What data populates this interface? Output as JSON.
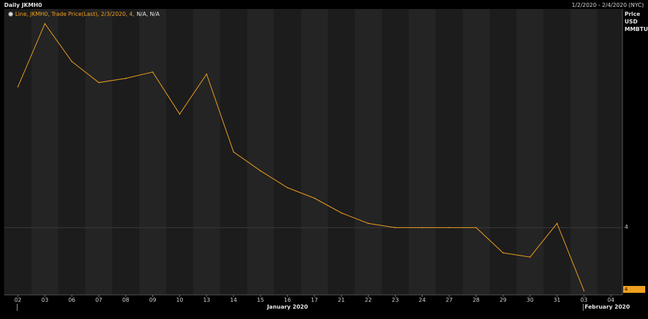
{
  "header": {
    "title": "Daily JKMH0",
    "date_range": "1/2/2020 - 2/4/2020 (NYC)"
  },
  "legend": {
    "series_text": "Line, JKMH0, Trade Price(Last), 2/3/2020, 4,",
    "na_text": "N/A, N/A",
    "icon": "settings-dot-icon"
  },
  "y_axis": {
    "units_lines": [
      "Price",
      "USD",
      "MMBTU"
    ],
    "tick_label": "4",
    "last_badge": "4"
  },
  "colors": {
    "background": "#000000",
    "plot_bg": "#1c1c1c",
    "column_alt": "#242424",
    "series": "#f0a020",
    "grid": "#3a3a3a"
  },
  "chart_data": {
    "type": "line",
    "title": "Daily JKMH0",
    "series": [
      {
        "name": "JKMH0 Trade Price(Last)",
        "x": [
          "2020-01-02",
          "2020-01-03",
          "2020-01-06",
          "2020-01-07",
          "2020-01-08",
          "2020-01-09",
          "2020-01-10",
          "2020-01-13",
          "2020-01-14",
          "2020-01-15",
          "2020-01-16",
          "2020-01-17",
          "2020-01-21",
          "2020-01-22",
          "2020-01-23",
          "2020-01-24",
          "2020-01-27",
          "2020-01-28",
          "2020-01-29",
          "2020-01-30",
          "2020-01-31",
          "2020-02-03"
        ],
        "values": [
          4.67,
          4.97,
          4.79,
          4.69,
          4.71,
          4.74,
          4.54,
          4.73,
          4.36,
          4.27,
          4.19,
          4.14,
          4.07,
          4.02,
          4.0,
          4.0,
          4.0,
          4.0,
          3.88,
          3.86,
          4.02,
          3.7
        ]
      }
    ],
    "x_tick_labels": [
      "02",
      "03",
      "06",
      "07",
      "08",
      "09",
      "10",
      "13",
      "14",
      "15",
      "16",
      "17",
      "21",
      "22",
      "23",
      "24",
      "27",
      "28",
      "29",
      "30",
      "31",
      "03",
      "04"
    ],
    "month_labels": [
      {
        "label": "January 2020",
        "from_tick": 0,
        "to_tick": 20
      },
      {
        "label": "February 2020",
        "from_tick": 21,
        "to_tick": 22
      }
    ],
    "y_ticks": [
      4
    ],
    "ylim": [
      3.68,
      5.04
    ],
    "grid": true,
    "legend_position": "top-left"
  }
}
